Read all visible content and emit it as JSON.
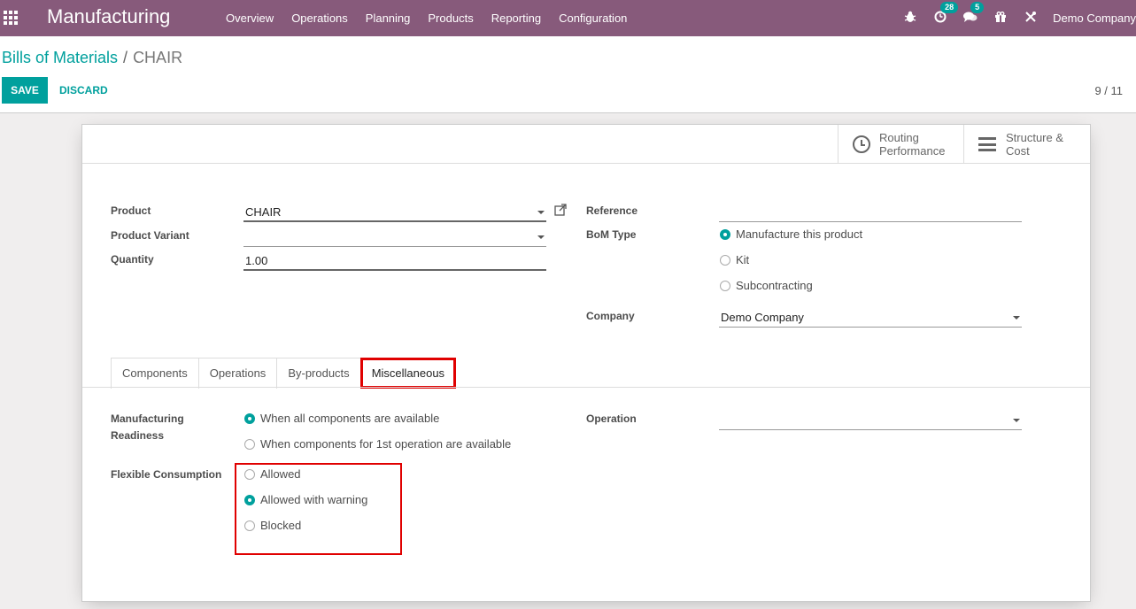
{
  "navbar": {
    "app_title": "Manufacturing",
    "menu": [
      "Overview",
      "Operations",
      "Planning",
      "Products",
      "Reporting",
      "Configuration"
    ],
    "activity_badge": "28",
    "messages_badge": "5",
    "company": "Demo Company",
    "icons": [
      "apps-icon",
      "bug-icon",
      "activity-icon",
      "chat-icon",
      "gift-icon",
      "tools-icon"
    ]
  },
  "breadcrumb": {
    "parent": "Bills of Materials",
    "separator": "/",
    "current": "CHAIR"
  },
  "actions": {
    "save": "SAVE",
    "discard": "DISCARD"
  },
  "pager": "9 / 11",
  "stat_buttons": {
    "routing_line1": "Routing",
    "routing_line2": "Performance",
    "structure_line1": "Structure &",
    "structure_line2": "Cost"
  },
  "form": {
    "product_label": "Product",
    "product_value": "CHAIR",
    "variant_label": "Product Variant",
    "variant_value": "",
    "quantity_label": "Quantity",
    "quantity_value": "1.00",
    "reference_label": "Reference",
    "reference_value": "",
    "bom_type_label": "BoM Type",
    "bom_type_options": [
      "Manufacture this product",
      "Kit",
      "Subcontracting"
    ],
    "bom_type_selected": "Manufacture this product",
    "company_label": "Company",
    "company_value": "Demo Company"
  },
  "tabs": [
    "Components",
    "Operations",
    "By-products",
    "Miscellaneous"
  ],
  "active_tab": "Miscellaneous",
  "misc": {
    "readiness_label_line1": "Manufacturing",
    "readiness_label_line2": "Readiness",
    "readiness_options": [
      "When all components are available",
      "When components for 1st operation are available"
    ],
    "readiness_selected": "When all components are available",
    "operation_label": "Operation",
    "operation_value": "",
    "consumption_label": "Flexible Consumption",
    "consumption_options": [
      "Allowed",
      "Allowed with warning",
      "Blocked"
    ],
    "consumption_selected": "Allowed with warning"
  },
  "colors": {
    "navbar": "#875a7b",
    "accent": "#00a09d",
    "highlight": "#e00000"
  }
}
